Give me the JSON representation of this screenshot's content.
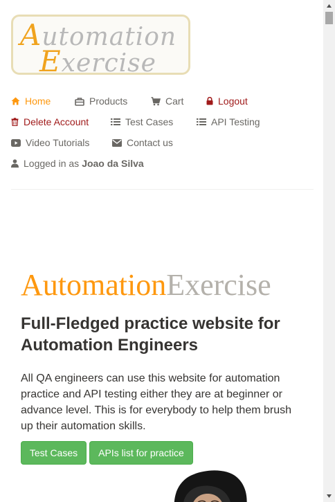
{
  "logo": {
    "line1_cap": "A",
    "line1_rest": "utomation",
    "line2_cap": "E",
    "line2_rest": "xercise"
  },
  "nav": {
    "home": "Home",
    "products": "Products",
    "cart": "Cart",
    "logout": "Logout",
    "delete_account": "Delete Account",
    "test_cases": "Test Cases",
    "api_testing": "API Testing",
    "video_tutorials": "Video Tutorials",
    "contact_us": "Contact us",
    "logged_in_prefix": "Logged in as",
    "logged_in_user": "Joao da Silva"
  },
  "hero": {
    "brand_part1": "Automation",
    "brand_part2": "Exercise",
    "headline": "Full-Fledged practice website for Automation Engineers",
    "description": "All QA engineers can use this website for automation practice and API testing either they are at beginner or advance level. This is for everybody to help them brush up their automation skills.",
    "button_test_cases": "Test Cases",
    "button_apis": "APIs list for practice"
  },
  "colors": {
    "accent": "#fe980f",
    "text": "#696763",
    "danger": "#a01b1b",
    "button": "#5cb85c"
  },
  "icons": {
    "home": "home-icon",
    "products": "shopping-bag-icon",
    "cart": "cart-icon",
    "logout": "lock-icon",
    "delete": "trash-icon",
    "test_cases": "list-icon",
    "api_testing": "list-icon",
    "video": "youtube-play-icon",
    "contact": "envelope-icon",
    "user": "user-icon"
  }
}
